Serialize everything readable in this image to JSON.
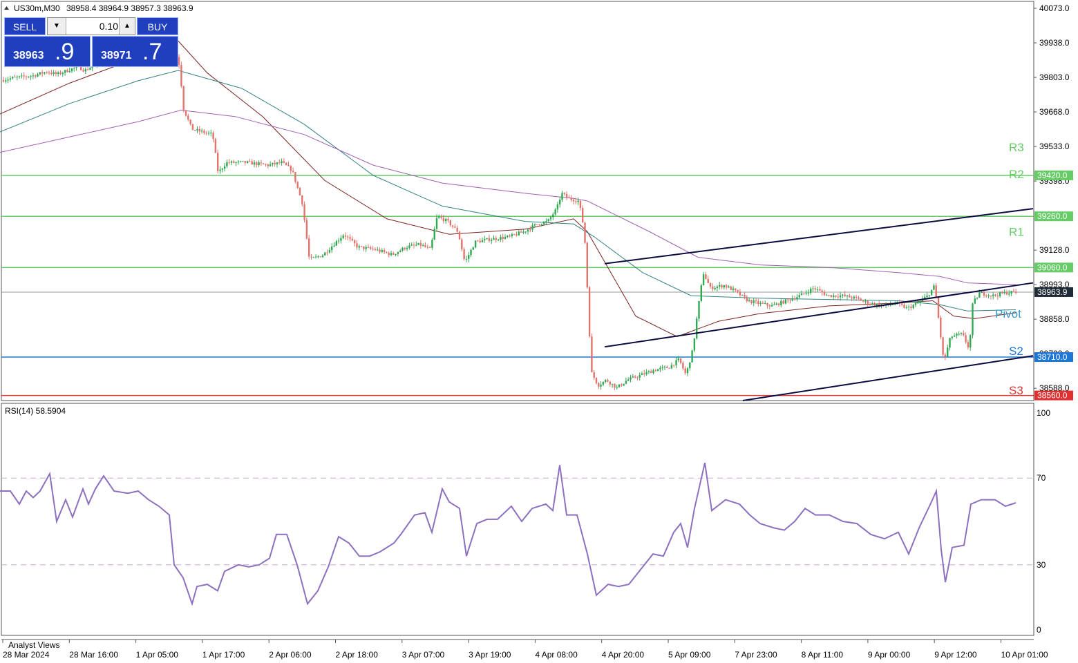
{
  "header": {
    "symbol_label": "US30m,M30",
    "ohlc": "38958.4 38964.9 38957.3 38963.9",
    "triangle_icon": "triangle-down-icon"
  },
  "trade_panel": {
    "sell_label": "SELL",
    "buy_label": "BUY",
    "lot_value": "0.10",
    "sell_price_main": "38963",
    "sell_price_big": ".9",
    "buy_price_main": "38971",
    "buy_price_big": ".7",
    "colors": {
      "button": "#1f3fbf"
    }
  },
  "chart_data": [
    {
      "type": "candlestick",
      "title": "US30m,M30",
      "ylim": [
        38540,
        40100
      ],
      "y_ticks": [
        "40073.0",
        "39938.0",
        "39803.0",
        "39668.0",
        "39533.0",
        "39398.0",
        "39128.0",
        "38993.0",
        "38858.0",
        "38723.0",
        "38588.0"
      ],
      "x_ticks": [
        "28 Mar 2024",
        "28 Mar 16:00",
        "1 Apr 05:00",
        "1 Apr 17:00",
        "2 Apr 06:00",
        "2 Apr 18:00",
        "3 Apr 07:00",
        "3 Apr 19:00",
        "4 Apr 08:00",
        "4 Apr 20:00",
        "5 Apr 09:00",
        "7 Apr 23:00",
        "8 Apr 11:00",
        "9 Apr 00:00",
        "9 Apr 12:00",
        "10 Apr 01:00"
      ],
      "current_price": "38963.9",
      "path_anchors": [
        [
          0,
          39790
        ],
        [
          20,
          39800
        ],
        [
          50,
          39810
        ],
        [
          70,
          39825
        ],
        [
          85,
          39815
        ],
        [
          100,
          39830
        ],
        [
          115,
          39845
        ],
        [
          125,
          39830
        ],
        [
          145,
          39860
        ],
        [
          165,
          39880
        ],
        [
          180,
          39900
        ],
        [
          195,
          39910
        ],
        [
          215,
          39925
        ],
        [
          235,
          39930
        ],
        [
          248,
          39940
        ],
        [
          255,
          39910
        ],
        [
          262,
          39850
        ],
        [
          268,
          39680
        ],
        [
          280,
          39600
        ],
        [
          295,
          39590
        ],
        [
          310,
          39580
        ],
        [
          318,
          39430
        ],
        [
          330,
          39470
        ],
        [
          360,
          39470
        ],
        [
          390,
          39460
        ],
        [
          410,
          39470
        ],
        [
          425,
          39440
        ],
        [
          440,
          39310
        ],
        [
          450,
          39090
        ],
        [
          470,
          39110
        ],
        [
          485,
          39150
        ],
        [
          500,
          39190
        ],
        [
          520,
          39140
        ],
        [
          545,
          39130
        ],
        [
          570,
          39110
        ],
        [
          590,
          39140
        ],
        [
          610,
          39150
        ],
        [
          625,
          39130
        ],
        [
          635,
          39260
        ],
        [
          650,
          39240
        ],
        [
          665,
          39200
        ],
        [
          675,
          39080
        ],
        [
          690,
          39160
        ],
        [
          710,
          39170
        ],
        [
          740,
          39180
        ],
        [
          760,
          39200
        ],
        [
          780,
          39230
        ],
        [
          795,
          39240
        ],
        [
          808,
          39290
        ],
        [
          815,
          39350
        ],
        [
          825,
          39330
        ],
        [
          840,
          39320
        ],
        [
          848,
          39200
        ],
        [
          852,
          38990
        ],
        [
          858,
          38650
        ],
        [
          868,
          38600
        ],
        [
          880,
          38620
        ],
        [
          895,
          38590
        ],
        [
          910,
          38620
        ],
        [
          930,
          38640
        ],
        [
          950,
          38660
        ],
        [
          970,
          38670
        ],
        [
          985,
          38700
        ],
        [
          995,
          38640
        ],
        [
          1005,
          38740
        ],
        [
          1012,
          38890
        ],
        [
          1020,
          39040
        ],
        [
          1030,
          38980
        ],
        [
          1050,
          38990
        ],
        [
          1065,
          38970
        ],
        [
          1085,
          38930
        ],
        [
          1100,
          38920
        ],
        [
          1120,
          38910
        ],
        [
          1140,
          38930
        ],
        [
          1160,
          38950
        ],
        [
          1180,
          38980
        ],
        [
          1200,
          38950
        ],
        [
          1220,
          38950
        ],
        [
          1240,
          38940
        ],
        [
          1260,
          38920
        ],
        [
          1280,
          38910
        ],
        [
          1300,
          38920
        ],
        [
          1315,
          38900
        ],
        [
          1330,
          38920
        ],
        [
          1345,
          38950
        ],
        [
          1355,
          38990
        ],
        [
          1360,
          38870
        ],
        [
          1368,
          38690
        ],
        [
          1378,
          38790
        ],
        [
          1395,
          38800
        ],
        [
          1405,
          38740
        ],
        [
          1410,
          38920
        ],
        [
          1420,
          38960
        ],
        [
          1440,
          38950
        ],
        [
          1455,
          38960
        ],
        [
          1470,
          38963.9
        ]
      ],
      "moving_averages": [
        {
          "color": "#7b2020",
          "points": [
            [
              0,
              39660
            ],
            [
              100,
              39780
            ],
            [
              200,
              39880
            ],
            [
              258,
              39945
            ],
            [
              300,
              39820
            ],
            [
              380,
              39650
            ],
            [
              470,
              39400
            ],
            [
              560,
              39250
            ],
            [
              650,
              39190
            ],
            [
              760,
              39210
            ],
            [
              830,
              39250
            ],
            [
              850,
              39200
            ],
            [
              920,
              38870
            ],
            [
              980,
              38790
            ],
            [
              1040,
              38850
            ],
            [
              1100,
              38880
            ],
            [
              1200,
              38910
            ],
            [
              1290,
              38920
            ],
            [
              1350,
              38930
            ],
            [
              1380,
              38870
            ],
            [
              1410,
              38860
            ],
            [
              1470,
              38883
            ]
          ]
        },
        {
          "color": "#2f8080",
          "points": [
            [
              0,
              39590
            ],
            [
              100,
              39700
            ],
            [
              200,
              39790
            ],
            [
              258,
              39830
            ],
            [
              350,
              39760
            ],
            [
              440,
              39620
            ],
            [
              540,
              39420
            ],
            [
              640,
              39300
            ],
            [
              760,
              39240
            ],
            [
              830,
              39230
            ],
            [
              860,
              39180
            ],
            [
              930,
              39040
            ],
            [
              1000,
              38950
            ],
            [
              1100,
              38940
            ],
            [
              1200,
              38935
            ],
            [
              1300,
              38930
            ],
            [
              1360,
              38915
            ],
            [
              1400,
              38890
            ],
            [
              1470,
              38895
            ]
          ]
        },
        {
          "color": "#a060b0",
          "points": [
            [
              0,
              39510
            ],
            [
              100,
              39570
            ],
            [
              200,
              39630
            ],
            [
              262,
              39675
            ],
            [
              340,
              39650
            ],
            [
              440,
              39580
            ],
            [
              540,
              39460
            ],
            [
              640,
              39390
            ],
            [
              760,
              39350
            ],
            [
              830,
              39330
            ],
            [
              850,
              39320
            ],
            [
              940,
              39200
            ],
            [
              1010,
              39100
            ],
            [
              1100,
              39070
            ],
            [
              1200,
              39060
            ],
            [
              1300,
              39040
            ],
            [
              1360,
              39025
            ],
            [
              1400,
              39000
            ],
            [
              1470,
              38993
            ]
          ]
        }
      ]
    },
    {
      "type": "line",
      "title": "RSI(14) 58.5904",
      "ylim": [
        0,
        100
      ],
      "y_ticks": [
        "100",
        "70",
        "30",
        "0"
      ],
      "levels": [
        70,
        30
      ],
      "series": [
        {
          "name": "RSI(14)",
          "color": "#8c6fbf",
          "points": [
            [
              0,
              64
            ],
            [
              15,
              64
            ],
            [
              28,
              58
            ],
            [
              38,
              64
            ],
            [
              48,
              61
            ],
            [
              58,
              64
            ],
            [
              72,
              72
            ],
            [
              82,
              50
            ],
            [
              95,
              60
            ],
            [
              105,
              52
            ],
            [
              120,
              65
            ],
            [
              128,
              58
            ],
            [
              138,
              65
            ],
            [
              150,
              71
            ],
            [
              165,
              64
            ],
            [
              185,
              63
            ],
            [
              200,
              64
            ],
            [
              215,
              60
            ],
            [
              230,
              57
            ],
            [
              245,
              53
            ],
            [
              252,
              30
            ],
            [
              265,
              24
            ],
            [
              278,
              12
            ],
            [
              285,
              20
            ],
            [
              300,
              21
            ],
            [
              315,
              18
            ],
            [
              325,
              27
            ],
            [
              345,
              30
            ],
            [
              360,
              29
            ],
            [
              375,
              30
            ],
            [
              390,
              33
            ],
            [
              400,
              44
            ],
            [
              415,
              44
            ],
            [
              430,
              30
            ],
            [
              445,
              12
            ],
            [
              460,
              18
            ],
            [
              475,
              29
            ],
            [
              490,
              43
            ],
            [
              505,
              40
            ],
            [
              520,
              34
            ],
            [
              535,
              34
            ],
            [
              550,
              36
            ],
            [
              570,
              40
            ],
            [
              580,
              44
            ],
            [
              600,
              53
            ],
            [
              615,
              54
            ],
            [
              625,
              45
            ],
            [
              640,
              65
            ],
            [
              650,
              59
            ],
            [
              665,
              56
            ],
            [
              675,
              34
            ],
            [
              690,
              49
            ],
            [
              705,
              51
            ],
            [
              720,
              51
            ],
            [
              740,
              57
            ],
            [
              755,
              50
            ],
            [
              770,
              56
            ],
            [
              790,
              58
            ],
            [
              800,
              55
            ],
            [
              810,
              76
            ],
            [
              820,
              53
            ],
            [
              835,
              53
            ],
            [
              850,
              35
            ],
            [
              863,
              16
            ],
            [
              880,
              21
            ],
            [
              895,
              20
            ],
            [
              910,
              21
            ],
            [
              925,
              27
            ],
            [
              945,
              35
            ],
            [
              960,
              34
            ],
            [
              975,
              45
            ],
            [
              985,
              49
            ],
            [
              995,
              38
            ],
            [
              1005,
              56
            ],
            [
              1020,
              77
            ],
            [
              1030,
              55
            ],
            [
              1050,
              60
            ],
            [
              1070,
              58
            ],
            [
              1085,
              53
            ],
            [
              1100,
              49
            ],
            [
              1120,
              47
            ],
            [
              1135,
              46
            ],
            [
              1150,
              50
            ],
            [
              1165,
              56
            ],
            [
              1180,
              53
            ],
            [
              1200,
              53
            ],
            [
              1220,
              50
            ],
            [
              1240,
              49
            ],
            [
              1260,
              44
            ],
            [
              1280,
              42
            ],
            [
              1300,
              45
            ],
            [
              1315,
              35
            ],
            [
              1330,
              47
            ],
            [
              1345,
              57
            ],
            [
              1355,
              64
            ],
            [
              1362,
              37
            ],
            [
              1368,
              22
            ],
            [
              1378,
              38
            ],
            [
              1395,
              39
            ],
            [
              1405,
              58
            ],
            [
              1420,
              60
            ],
            [
              1440,
              60
            ],
            [
              1455,
              57
            ],
            [
              1470,
              58.59
            ]
          ]
        }
      ]
    }
  ],
  "overlays": {
    "pivot_levels": [
      {
        "label": "R3",
        "value": null,
        "price_tag": "",
        "color": "#66cc66",
        "line": false,
        "label_y_value": 39530
      },
      {
        "label": "R2",
        "value": 39420.0,
        "price_tag": "39420.0",
        "color": "#66cc66",
        "line": true,
        "label_y_value": 39425
      },
      {
        "label": "R1",
        "value": 39260.0,
        "price_tag": "39260.0",
        "color": "#66cc66",
        "line": true,
        "label_y_value": 39200
      },
      {
        "label": "",
        "value": 39060.0,
        "price_tag": "39060.0",
        "color": "#66cc66",
        "line": true,
        "label_y_value": null
      },
      {
        "label": "Pivot",
        "value": null,
        "price_tag": "",
        "color": "#3399cc",
        "line": false,
        "label_y_value": 38880
      },
      {
        "label": "S2",
        "value": 38710.0,
        "price_tag": "38710.0",
        "color": "#1f77d4",
        "line": true,
        "label_y_value": 38735
      },
      {
        "label": "S3",
        "value": 38560.0,
        "price_tag": "38560.0",
        "color": "#e03030",
        "line": true,
        "label_y_value": 38580
      }
    ],
    "pivot_label_texts": {
      "r3": "R3",
      "r2": "R2",
      "r1": "R1",
      "pivot": "Pivot",
      "s2": "S2",
      "s3": "S3"
    },
    "current_price_tag": "38963.9",
    "trend_lines": [
      {
        "from": [
          875,
          39075
        ],
        "to": [
          1495,
          39290
        ]
      },
      {
        "from": [
          875,
          38750
        ],
        "to": [
          1495,
          39000
        ]
      },
      {
        "from": [
          1075,
          38540
        ],
        "to": [
          1495,
          38715
        ]
      }
    ],
    "watermark": "Analyst Views",
    "rsi_axis_labels": {
      "t100": "100",
      "t70": "70",
      "t30": "30",
      "t0": "0"
    }
  }
}
